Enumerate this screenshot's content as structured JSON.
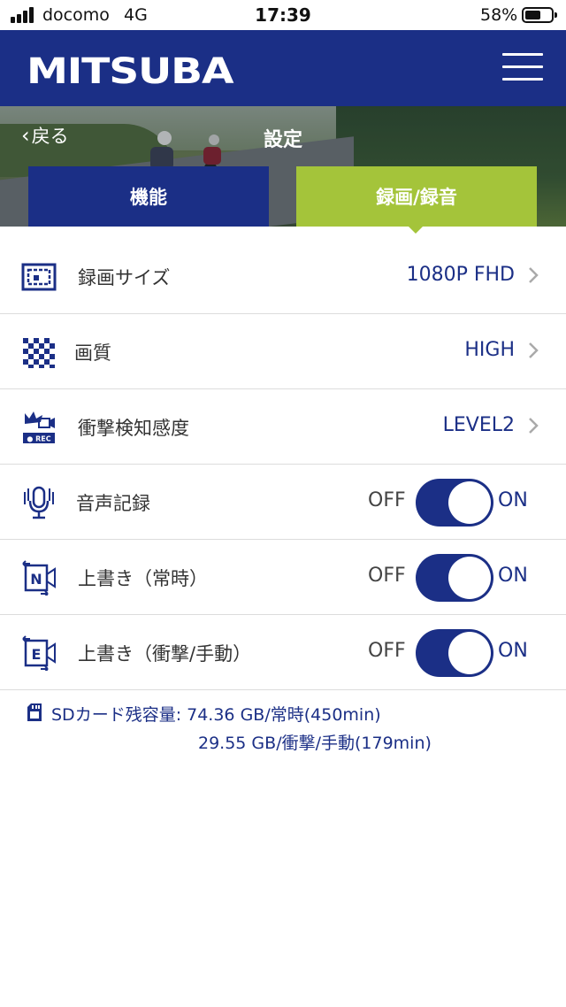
{
  "status_bar": {
    "carrier": "docomo",
    "network": "4G",
    "time": "17:39",
    "battery": "58%"
  },
  "header": {
    "logo": "MITSUBA"
  },
  "nav": {
    "back_label": "戻る",
    "title": "設定"
  },
  "tabs": [
    {
      "label": "機能",
      "active": false
    },
    {
      "label": "録画/録音",
      "active": true
    }
  ],
  "settings": {
    "recording_size": {
      "label": "録画サイズ",
      "value": "1080P FHD"
    },
    "quality": {
      "label": "画質",
      "value": "HIGH"
    },
    "impact_sensitivity": {
      "label": "衝撃検知感度",
      "value": "LEVEL2"
    },
    "audio_recording": {
      "label": "音声記録",
      "off_label": "OFF",
      "on_label": "ON",
      "state": "on"
    },
    "overwrite_normal": {
      "label": "上書き（常時）",
      "off_label": "OFF",
      "on_label": "ON",
      "state": "on"
    },
    "overwrite_event": {
      "label": "上書き（衝撃/手動）",
      "off_label": "OFF",
      "on_label": "ON",
      "state": "on"
    }
  },
  "impact_icon_text": "● REC",
  "sd_card": {
    "line1": "SDカード残容量: 74.36 GB/常時(450min)",
    "line2": "29.55 GB/衝撃/手動(179min)"
  },
  "colors": {
    "brand_navy": "#1b2f86",
    "accent_green": "#a4c43a"
  }
}
